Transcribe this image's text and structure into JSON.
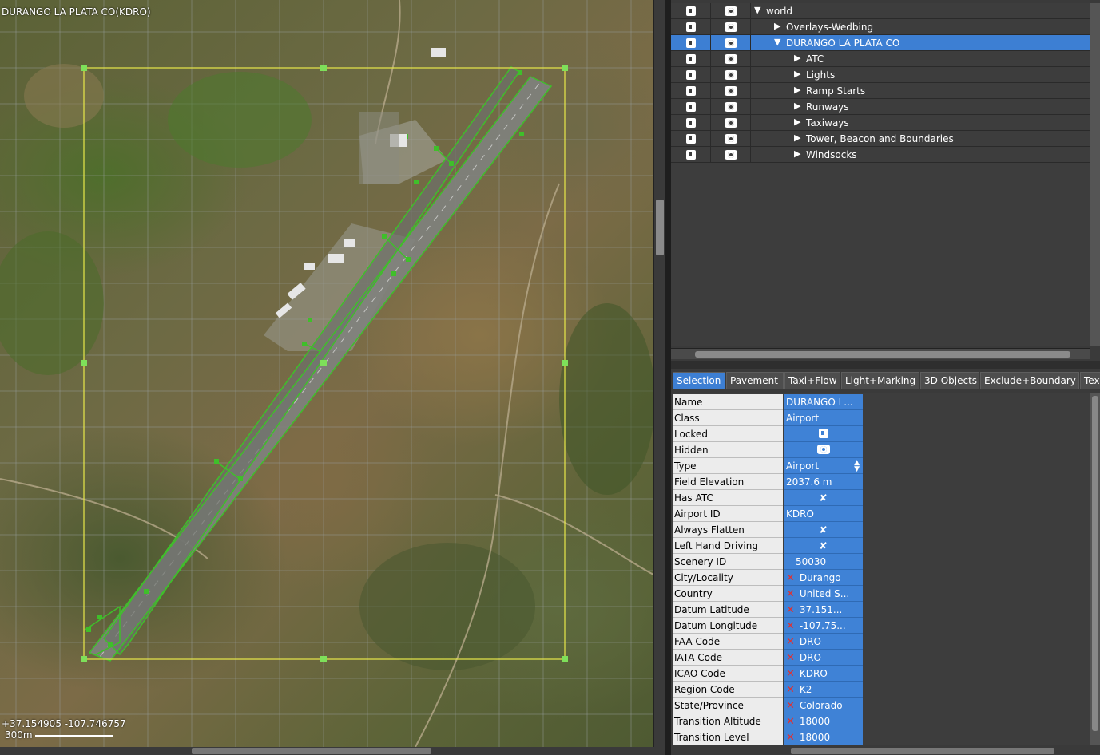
{
  "map": {
    "title": "DURANGO LA PLATA CO(KDRO)",
    "coords": "+37.154905 -107.746757",
    "scale": "300m"
  },
  "tree": {
    "rows": [
      {
        "label": "world",
        "expanded": true,
        "selected": false
      },
      {
        "label": "Overlays-Wedbing",
        "expanded": false,
        "selected": false
      },
      {
        "label": "DURANGO LA PLATA CO",
        "expanded": true,
        "selected": true
      },
      {
        "label": "ATC",
        "expanded": false,
        "selected": false
      },
      {
        "label": "Lights",
        "expanded": false,
        "selected": false
      },
      {
        "label": "Ramp Starts",
        "expanded": false,
        "selected": false
      },
      {
        "label": "Runways",
        "expanded": false,
        "selected": false
      },
      {
        "label": "Taxiways",
        "expanded": false,
        "selected": false
      },
      {
        "label": "Tower, Beacon and Boundaries",
        "expanded": false,
        "selected": false
      },
      {
        "label": "Windsocks",
        "expanded": false,
        "selected": false
      }
    ]
  },
  "tabs": [
    "Selection",
    "Pavement",
    "Taxi+Flow",
    "Light+Marking",
    "3D Objects",
    "Exclude+Boundary",
    "Text"
  ],
  "properties": [
    {
      "name": "Name",
      "value": "DURANGO L...",
      "kind": "text"
    },
    {
      "name": "Class",
      "value": "Airport",
      "kind": "text"
    },
    {
      "name": "Locked",
      "value": "",
      "kind": "lock"
    },
    {
      "name": "Hidden",
      "value": "",
      "kind": "eye"
    },
    {
      "name": "Type",
      "value": "Airport",
      "kind": "enum"
    },
    {
      "name": "Field Elevation",
      "value": "2037.6 m",
      "kind": "text"
    },
    {
      "name": "Has ATC",
      "value": "✘",
      "kind": "check"
    },
    {
      "name": "Airport ID",
      "value": "KDRO",
      "kind": "text"
    },
    {
      "name": "Always Flatten",
      "value": "✘",
      "kind": "check"
    },
    {
      "name": "Left Hand Driving",
      "value": "✘",
      "kind": "check"
    },
    {
      "name": "Scenery ID",
      "value": "50030",
      "kind": "num"
    },
    {
      "name": "City/Locality",
      "value": "Durango",
      "kind": "meta"
    },
    {
      "name": "Country",
      "value": "United S...",
      "kind": "meta"
    },
    {
      "name": "Datum Latitude",
      "value": "37.151...",
      "kind": "meta"
    },
    {
      "name": "Datum Longitude",
      "value": "-107.75...",
      "kind": "meta"
    },
    {
      "name": "FAA Code",
      "value": "DRO",
      "kind": "meta"
    },
    {
      "name": "IATA Code",
      "value": "DRO",
      "kind": "meta"
    },
    {
      "name": "ICAO Code",
      "value": "KDRO",
      "kind": "meta"
    },
    {
      "name": "Region Code",
      "value": "K2",
      "kind": "meta"
    },
    {
      "name": "State/Province",
      "value": "Colorado",
      "kind": "meta"
    },
    {
      "name": "Transition Altitude",
      "value": "18000",
      "kind": "meta"
    },
    {
      "name": "Transition Level",
      "value": "18000",
      "kind": "meta"
    }
  ],
  "colors": {
    "selection": "#3d7fd3",
    "boundary": "#e8e84a",
    "taxiway": "#3fbf2a",
    "delete_x": "#e23030"
  }
}
